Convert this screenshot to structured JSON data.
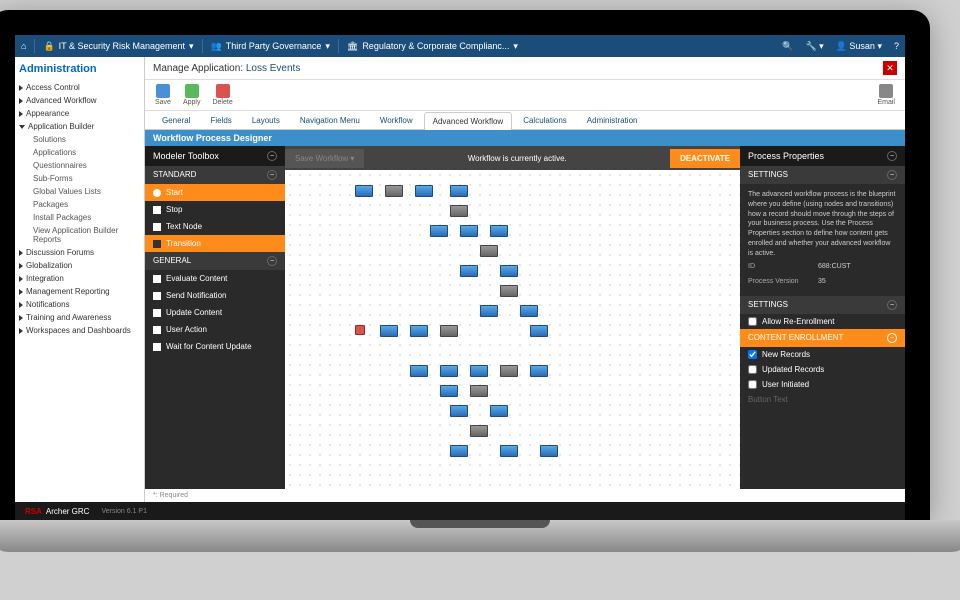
{
  "topbar": {
    "nav1": "IT & Security Risk Management",
    "nav2": "Third Party Governance",
    "nav3": "Regulatory & Corporate Complianc...",
    "user": "Susan"
  },
  "sidebar": {
    "title": "Administration",
    "items": [
      {
        "label": "Access Control"
      },
      {
        "label": "Advanced Workflow"
      },
      {
        "label": "Appearance"
      },
      {
        "label": "Application Builder",
        "expanded": true,
        "children": [
          "Solutions",
          "Applications",
          "Questionnaires",
          "Sub-Forms",
          "Global Values Lists",
          "Packages",
          "Install Packages",
          "View Application Builder Reports"
        ]
      },
      {
        "label": "Discussion Forums"
      },
      {
        "label": "Globalization"
      },
      {
        "label": "Integration"
      },
      {
        "label": "Management Reporting"
      },
      {
        "label": "Notifications"
      },
      {
        "label": "Training and Awareness"
      },
      {
        "label": "Workspaces and Dashboards"
      }
    ]
  },
  "page": {
    "title_prefix": "Manage Application: ",
    "title_name": "Loss Events"
  },
  "toolbar": {
    "save": "Save",
    "apply": "Apply",
    "delete": "Delete",
    "email": "Email"
  },
  "tabs": [
    "General",
    "Fields",
    "Layouts",
    "Navigation Menu",
    "Workflow",
    "Advanced Workflow",
    "Calculations",
    "Administration"
  ],
  "section_title": "Workflow Process Designer",
  "toolbox": {
    "title": "Modeler Toolbox",
    "standard": "STANDARD",
    "standard_items": [
      "Start",
      "Stop",
      "Text Node",
      "Transition"
    ],
    "general": "GENERAL",
    "general_items": [
      "Evaluate Content",
      "Send Notification",
      "Update Content",
      "User Action",
      "Wait for Content Update"
    ]
  },
  "canvas": {
    "save_btn": "Save Workflow",
    "status": "Workflow is currently active.",
    "deactivate": "DEACTIVATE"
  },
  "props": {
    "title": "Process Properties",
    "settings": "SETTINGS",
    "desc": "The advanced workflow process is the blueprint where you define (using nodes and transitions) how a record should move through the steps of your business process. Use the Process Properties section to define how content gets enrolled and whether your advanced workflow is active.",
    "id_label": "ID",
    "id_val": "688:CUST",
    "ver_label": "Process Version",
    "ver_val": "35",
    "settings2": "SETTINGS",
    "allow_re": "Allow Re-Enrollment",
    "enroll": "CONTENT ENROLLMENT",
    "new_rec": "New Records",
    "upd_rec": "Updated Records",
    "user_init": "User Initiated",
    "btn_txt": "Button Text"
  },
  "footer": {
    "brand": "RSA",
    "product": "Archer GRC",
    "version": "Version 6.1 P1"
  },
  "required": "*: Required"
}
